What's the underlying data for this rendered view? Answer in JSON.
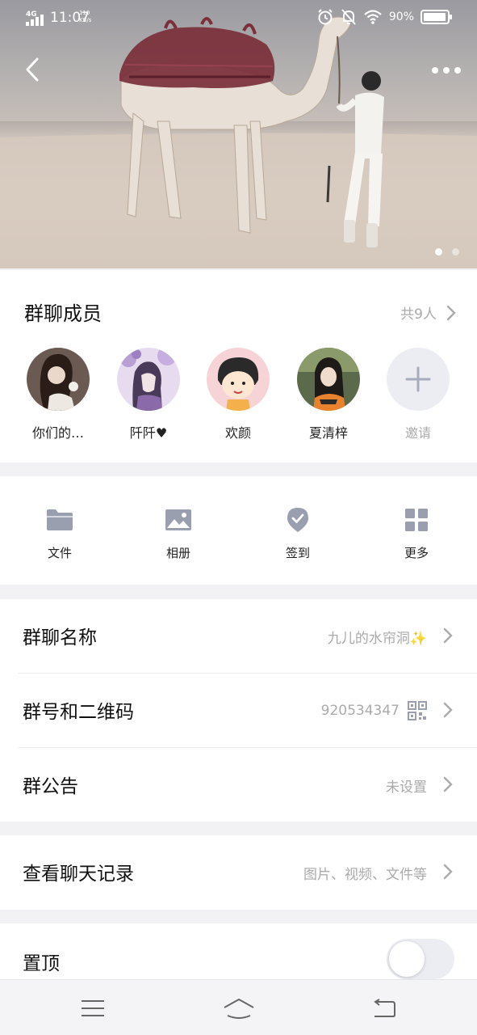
{
  "status_bar": {
    "network": "4G",
    "time": "11:07",
    "speed_value": "110",
    "speed_unit": "KB/s",
    "battery": "90%"
  },
  "header": {
    "back_icon": "chevron-left-icon",
    "more_icon": "more-horizontal-icon",
    "carousel_pages": 2,
    "carousel_active": 0
  },
  "members": {
    "title": "群聊成员",
    "count": "共9人",
    "list": [
      {
        "name": "你们的…",
        "avatar": "avatar-photo-woman"
      },
      {
        "name": "阡阡♥",
        "avatar": "avatar-illustration-purple"
      },
      {
        "name": "欢颜",
        "avatar": "avatar-cartoon-girl"
      },
      {
        "name": "夏清梓",
        "avatar": "avatar-photo-girl"
      }
    ],
    "invite_label": "邀请"
  },
  "tools": [
    {
      "label": "文件",
      "icon": "folder-icon"
    },
    {
      "label": "相册",
      "icon": "image-icon"
    },
    {
      "label": "签到",
      "icon": "checkin-icon"
    },
    {
      "label": "更多",
      "icon": "grid-icon"
    }
  ],
  "settings": {
    "group_name": {
      "title": "群聊名称",
      "value": "九儿的水帘洞✨"
    },
    "group_qr": {
      "title": "群号和二维码",
      "value": "920534347"
    },
    "announcement": {
      "title": "群公告",
      "value": "未设置"
    }
  },
  "history": {
    "title": "查看聊天记录",
    "value": "图片、视频、文件等"
  },
  "pin": {
    "title": "置顶",
    "enabled": false
  },
  "colors": {
    "icon_grey": "#9a9fb0",
    "text_grey": "#aaaaaa",
    "bg": "#f2f2f5"
  }
}
